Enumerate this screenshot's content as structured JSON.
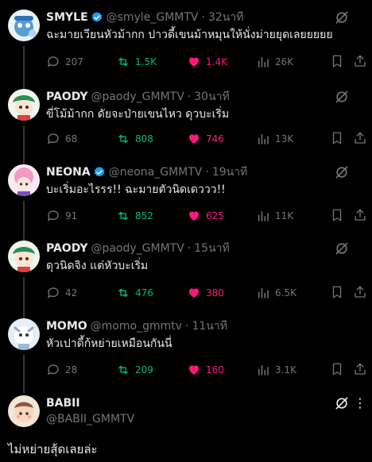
{
  "colors": {
    "background": "#000000",
    "text": "#e7e9ea",
    "muted": "#71767b",
    "retweet": "#00ba7c",
    "like": "#f91880",
    "verified": "#1d9bf0"
  },
  "tweets": [
    {
      "name": "SMYLE",
      "verified": true,
      "handle": "@smyle_GMMTV",
      "time": "32นาที",
      "text": "ฉะมายเวียนหัวม้ากก ปาวดี้เขนม้าหมุนให้นั่งม่ายยุดเลยยยยย",
      "replies": "207",
      "retweets": "1.5K",
      "likes": "1.4K",
      "views": "26K",
      "liked": true,
      "avatar_icon": "smyle-avatar"
    },
    {
      "name": "PAODY",
      "verified": false,
      "handle": "@paody_GMMTV",
      "time": "30นาที",
      "text": "ขี่โม้ม้ากก ดัยจะป่ายเขนไหว ดุวบะเริ่ม",
      "replies": "68",
      "retweets": "808",
      "likes": "746",
      "views": "13K",
      "liked": true,
      "avatar_icon": "paody-avatar"
    },
    {
      "name": "NEONA",
      "verified": true,
      "handle": "@neona_GMMTV",
      "time": "19นาที",
      "text": "บะเริ่มอะไรรร!! ฉะมายตัวนิดเดววว!!",
      "replies": "91",
      "retweets": "852",
      "likes": "625",
      "views": "11K",
      "liked": true,
      "avatar_icon": "neona-avatar"
    },
    {
      "name": "PAODY",
      "verified": false,
      "handle": "@paody_GMMTV",
      "time": "15นาที",
      "text": "ดุวนิดจิง แต่หัวบะเริ่ม",
      "replies": "42",
      "retweets": "476",
      "likes": "380",
      "views": "6.5K",
      "liked": true,
      "avatar_icon": "paody-avatar"
    },
    {
      "name": "MOMO",
      "verified": false,
      "handle": "@momo_gmmtv",
      "time": "11นาที",
      "text": "หัวเปาดี้ก้หย่ายเหมือนกันนี่",
      "replies": "28",
      "retweets": "209",
      "likes": "160",
      "views": "3.1K",
      "liked": true,
      "avatar_icon": "momo-avatar"
    }
  ],
  "focused_tweet": {
    "name": "BABII",
    "handle": "@BABII_GMMTV",
    "text": "ไม่หย่ายสุ้ดเลยล่ะ",
    "avatar_icon": "babii-avatar"
  },
  "separator": "·"
}
